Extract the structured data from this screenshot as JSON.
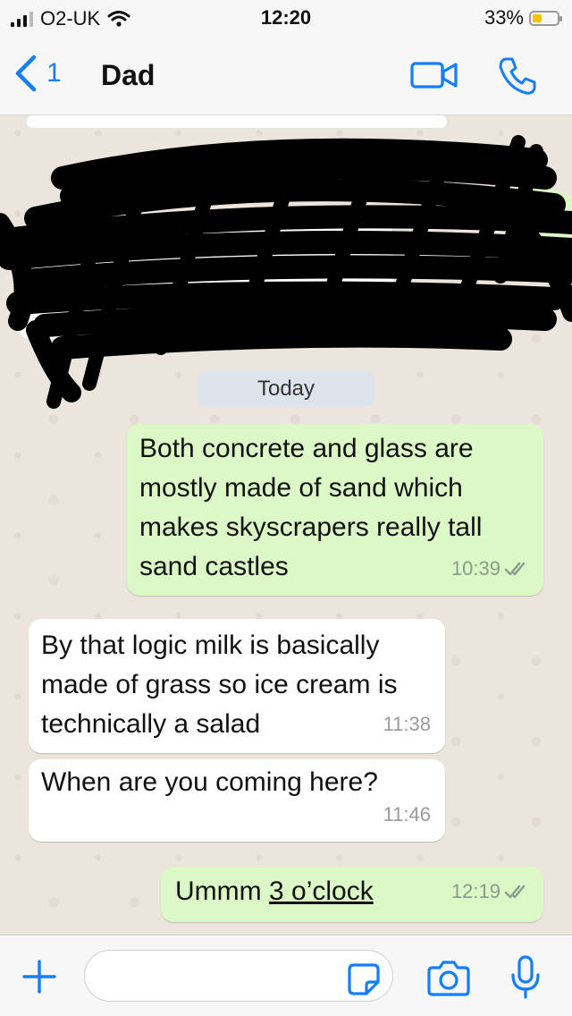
{
  "status": {
    "carrier": "O2-UK",
    "time": "12:20",
    "battery": "33%"
  },
  "nav": {
    "back_count": "1",
    "title": "Dad"
  },
  "chat": {
    "date_label": "Today",
    "messages": [
      {
        "direction": "out",
        "text": "Both concrete and glass are mostly made of sand which makes skyscrapers really tall sand castles",
        "time": "10:39"
      },
      {
        "direction": "in",
        "text": "By that logic milk is basically made of grass so ice cream is technically a salad",
        "time": "11:38"
      },
      {
        "direction": "in",
        "text": "When are you coming here?",
        "time": "11:46"
      },
      {
        "direction": "out",
        "text_prefix": "Ummm ",
        "text_link": "3 o’clock",
        "time": "12:19"
      }
    ]
  },
  "colors": {
    "accent": "#147efb",
    "outgoing": "#dcf8c6",
    "incoming": "#ffffff",
    "background": "#ece5dd"
  },
  "icons": [
    "signal-icon",
    "wifi-icon",
    "battery-icon",
    "back-chevron-icon",
    "video-call-icon",
    "phone-call-icon",
    "read-ticks-icon",
    "plus-icon",
    "sticker-icon",
    "camera-icon",
    "microphone-icon"
  ]
}
